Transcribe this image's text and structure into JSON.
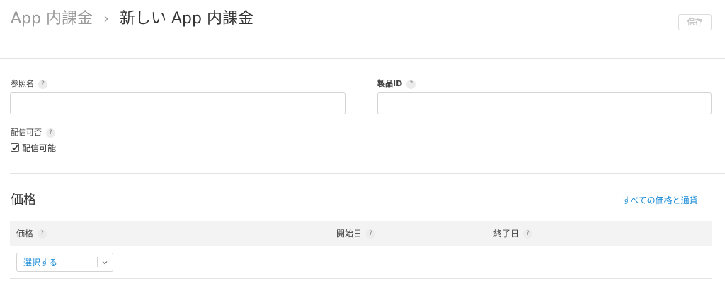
{
  "header": {
    "breadcrumb_parent": "App 内課金",
    "breadcrumb_separator": "›",
    "breadcrumb_current": "新しい App 内課金",
    "save_label": "保存"
  },
  "form": {
    "reference_name_label": "参照名",
    "product_id_label": "製品ID",
    "availability_label": "配信可否",
    "availability_checkbox_label": "配信可能",
    "availability_checked": true,
    "help_glyph": "?"
  },
  "pricing": {
    "section_title": "価格",
    "all_prices_link": "すべての価格と通貨",
    "columns": {
      "price": "価格",
      "start_date": "開始日",
      "end_date": "終了日"
    },
    "select_value": "選択する"
  },
  "colors": {
    "link": "#1a8cd8",
    "muted": "#9a9a9a"
  }
}
